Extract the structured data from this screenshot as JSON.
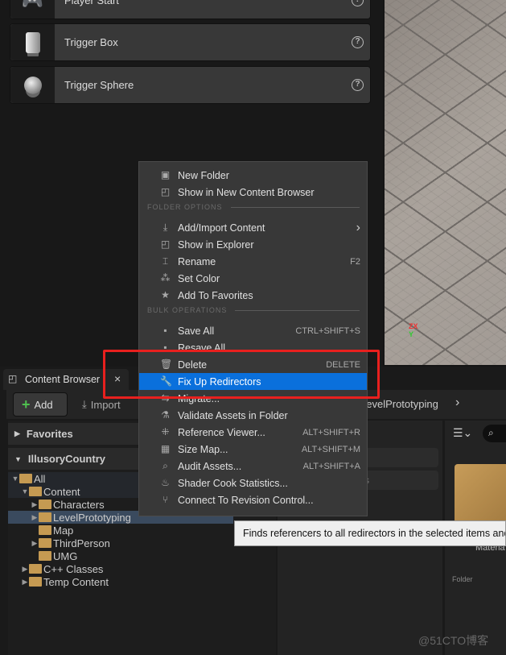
{
  "placeActors": [
    {
      "label": "Player Start",
      "icon": "gamepad-icon"
    },
    {
      "label": "Trigger Box",
      "icon": "trigger-box-icon"
    },
    {
      "label": "Trigger Sphere",
      "icon": "trigger-sphere-icon"
    }
  ],
  "contentBrowser": {
    "tab": "Content Browser",
    "close": "×",
    "add": "Add",
    "import": "Import",
    "breadcrumb": "LevelPrototyping",
    "favorites": "Favorites",
    "project": "IllusoryCountry",
    "tree": [
      {
        "label": "All",
        "depth": 0,
        "arrow": "▼"
      },
      {
        "label": "Content",
        "depth": 1,
        "arrow": "▼"
      },
      {
        "label": "Characters",
        "depth": 2,
        "arrow": "▶"
      },
      {
        "label": "LevelPrototyping",
        "depth": 2,
        "arrow": "▶",
        "selected": true
      },
      {
        "label": "Map",
        "depth": 2,
        "arrow": ""
      },
      {
        "label": "ThirdPerson",
        "depth": 2,
        "arrow": "▶"
      },
      {
        "label": "UMG",
        "depth": 2,
        "arrow": ""
      },
      {
        "label": "C++ Classes",
        "depth": 1,
        "arrow": "▶"
      },
      {
        "label": "Temp Content",
        "depth": 1,
        "arrow": "▶"
      }
    ],
    "midFilterText": "rs",
    "assetTypeLabel": "Materia",
    "assetKind": "Folder"
  },
  "menu": {
    "items": [
      {
        "label": "New Folder",
        "icon": "new-folder-icon",
        "glyph": "▣"
      },
      {
        "label": "Show in New Content Browser",
        "icon": "folder-search-icon",
        "glyph": "◰"
      },
      {
        "section": "FOLDER OPTIONS"
      },
      {
        "label": "Add/Import Content",
        "icon": "import-icon",
        "glyph": "⤓",
        "submenu": "›"
      },
      {
        "label": "Show in Explorer",
        "icon": "folder-search-icon",
        "glyph": "◰"
      },
      {
        "label": "Rename",
        "icon": "rename-icon",
        "glyph": "⌶",
        "shortcut": "F2"
      },
      {
        "label": "Set Color",
        "icon": "color-icon",
        "glyph": "⁂"
      },
      {
        "label": "Add To Favorites",
        "icon": "star-icon",
        "glyph": "★"
      },
      {
        "section": "BULK OPERATIONS"
      },
      {
        "label": "Save All",
        "icon": "save-icon",
        "glyph": "▪",
        "shortcut": "CTRL+SHIFT+S"
      },
      {
        "label": "Resave All",
        "icon": "save-icon",
        "glyph": "▪"
      },
      {
        "label": "Delete",
        "icon": "trash-icon",
        "glyph": "🗑",
        "shortcut": "DELETE"
      },
      {
        "label": "Fix Up Redirectors",
        "icon": "wrench-icon",
        "glyph": "🔧",
        "selected": true
      },
      {
        "label": "Migrate...",
        "icon": "migrate-icon",
        "glyph": "⇆"
      },
      {
        "label": "Validate Assets in Folder",
        "icon": "flask-icon",
        "glyph": "⚗"
      },
      {
        "label": "Reference Viewer...",
        "icon": "reference-icon",
        "glyph": "⁜",
        "shortcut": "ALT+SHIFT+R"
      },
      {
        "label": "Size Map...",
        "icon": "size-map-icon",
        "glyph": "▦",
        "shortcut": "ALT+SHIFT+M"
      },
      {
        "label": "Audit Assets...",
        "icon": "audit-icon",
        "glyph": "⌕",
        "shortcut": "ALT+SHIFT+A"
      },
      {
        "label": "Shader Cook Statistics...",
        "icon": "shader-icon",
        "glyph": "♨"
      },
      {
        "label": "Connect To Revision Control...",
        "icon": "branch-icon",
        "glyph": "⑂"
      }
    ]
  },
  "tooltip": "Finds referencers to all redirectors in the selected items and re",
  "watermark": "@51CTO博客",
  "colors": {
    "highlight": "#0a70dc",
    "annotation": "#e8201e",
    "folder": "#c59a52"
  }
}
